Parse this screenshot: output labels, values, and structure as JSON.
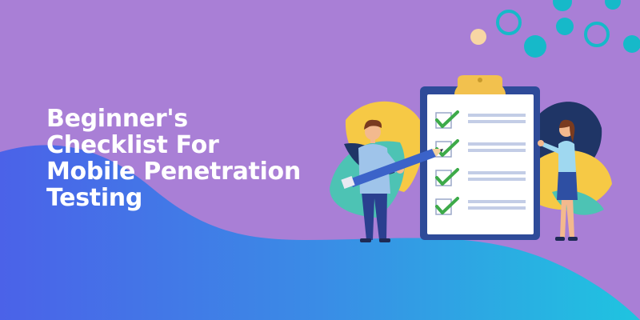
{
  "banner": {
    "title_lines": [
      "Beginner's",
      "Checklist For",
      "Mobile Penetration",
      "Testing"
    ]
  },
  "colors": {
    "background": "#a97fd6",
    "wave_blue": "#3f7fe6",
    "wave_cyan": "#22bfe0",
    "clipboard_frame": "#2e4b99",
    "clip_gold": "#f2c14e",
    "check_green": "#3daa49",
    "leaf_yellow": "#f6c945",
    "leaf_teal": "#4dc3b4",
    "leaf_navy": "#1f3566",
    "dot_teal": "#16b9c9",
    "dot_peach": "#f8d6a4"
  },
  "illustration": {
    "checklist_items": [
      {
        "checked": true
      },
      {
        "checked": true
      },
      {
        "checked": true
      },
      {
        "checked": true
      }
    ]
  }
}
